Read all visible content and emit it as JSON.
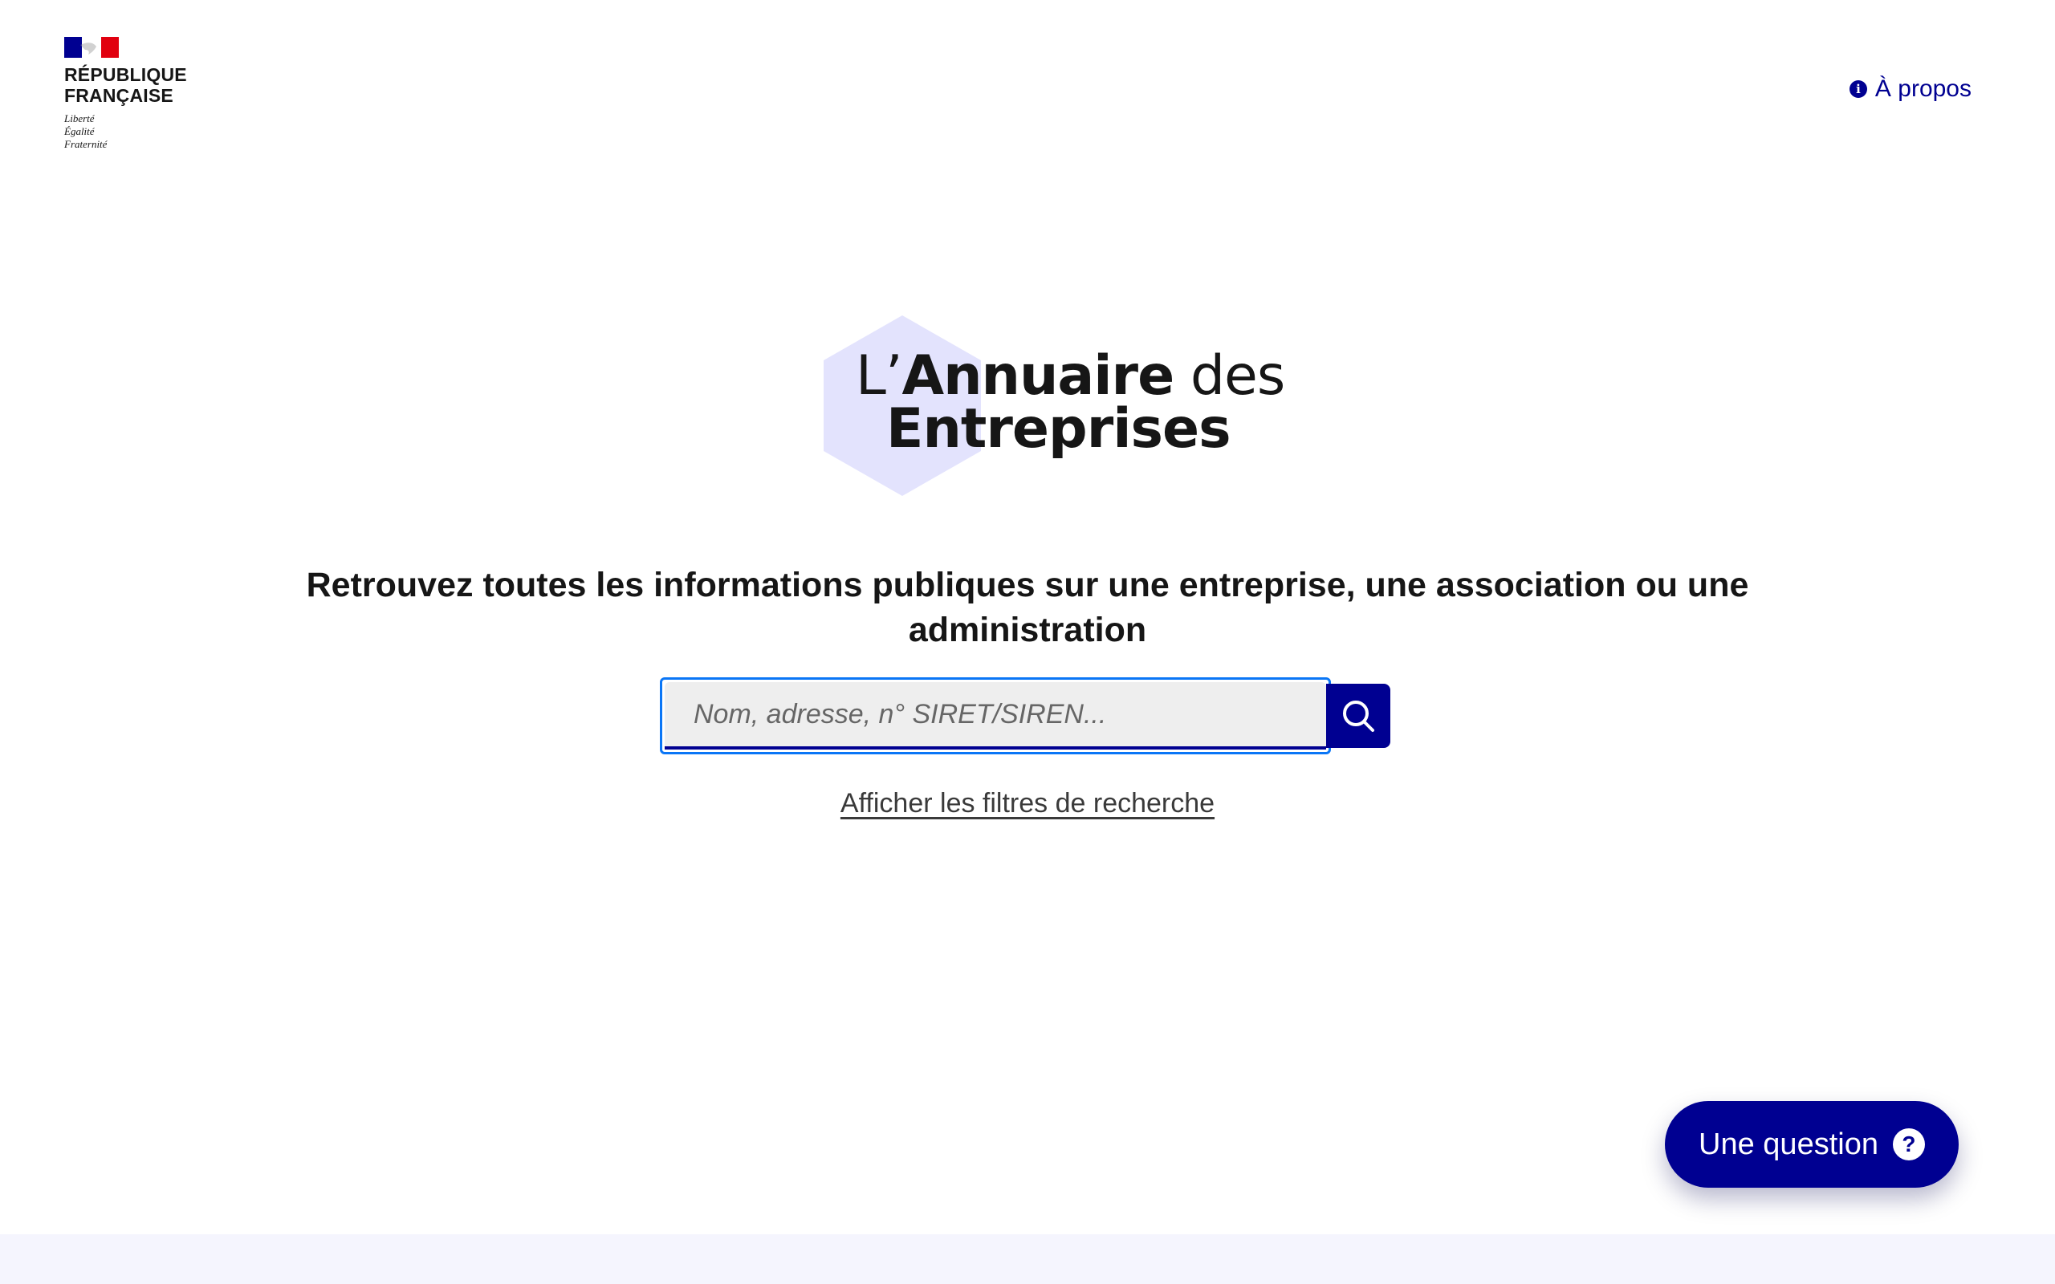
{
  "header": {
    "gov_name_line1": "RÉPUBLIQUE",
    "gov_name_line2": "FRANÇAISE",
    "motto": [
      "Liberté",
      "Égalité",
      "Fraternité"
    ],
    "about_label": "À propos",
    "about_icon": "info-icon"
  },
  "brand": {
    "prefix": "L’",
    "bold_word": "Annuaire",
    "suffix": " des",
    "line2": "Entreprises"
  },
  "hero": {
    "tagline": "Retrouvez toutes les informations publiques sur une entreprise, une association ou une administration"
  },
  "search": {
    "placeholder": "Nom, adresse, n° SIRET/SIREN...",
    "value": "",
    "button_icon": "search-icon",
    "filters_label": "Afficher les filtres de recherche"
  },
  "help": {
    "label": "Une question",
    "icon": "question-icon"
  },
  "colors": {
    "primary": "#000091",
    "focus": "#0a76f6",
    "hexagon": "#e3e3fd",
    "flag_blue": "#000091",
    "flag_red": "#e1000f",
    "footer_bg": "#f5f5fe"
  }
}
